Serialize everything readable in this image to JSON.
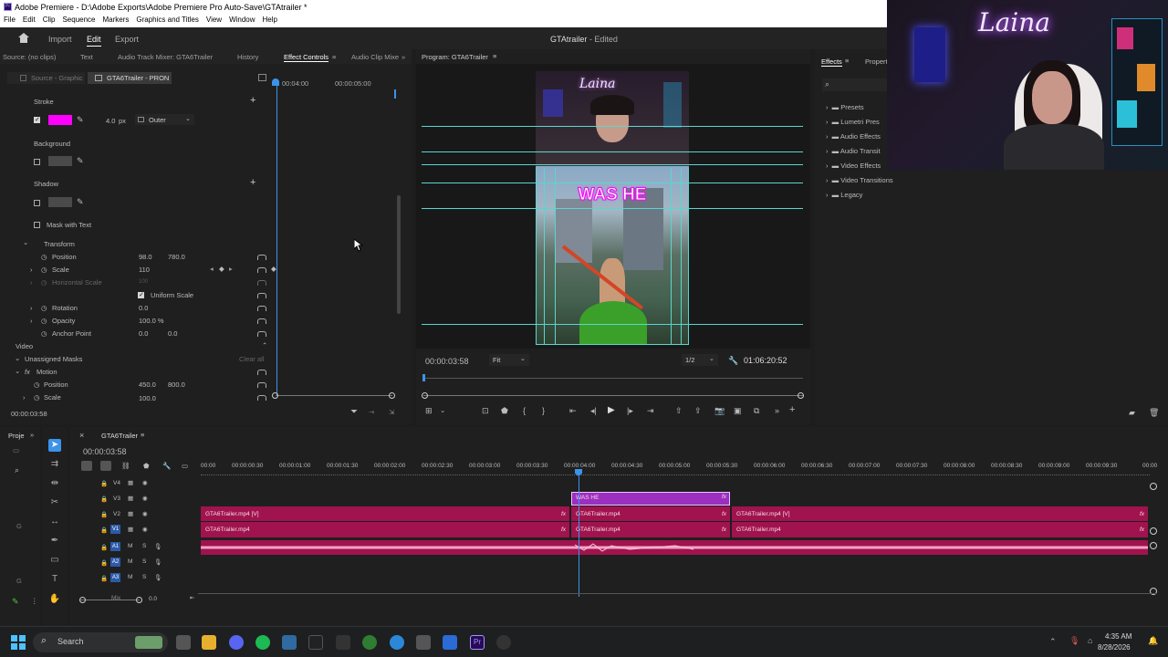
{
  "window": {
    "title": "Adobe Premiere - D:\\Adobe Exports\\Adobe Premiere Pro Auto-Save\\GTAtrailer *"
  },
  "menu": [
    "File",
    "Edit",
    "Clip",
    "Sequence",
    "Markers",
    "Graphics and Titles",
    "View",
    "Window",
    "Help"
  ],
  "appbar": {
    "import": "Import",
    "edit": "Edit",
    "export": "Export",
    "project_title": "GTAtrailer",
    "edited": "- Edited"
  },
  "source_tabs": {
    "source": "Source: (no clips)",
    "text": "Text",
    "audio_mixer": "Audio Track Mixer: GTA6Trailer",
    "history": "History",
    "effect_controls": "Effect Controls",
    "audio_clip": "Audio Clip Mixe"
  },
  "effect_controls": {
    "master": "Source - Graphic",
    "clip": "GTA6Trailer - PRON",
    "ruler_a": "00:04:00",
    "ruler_b": "00:00:05:00",
    "stroke": {
      "label": "Stroke",
      "color": "#ff00ff",
      "width": "4.0",
      "unit": "px",
      "position": "Outer"
    },
    "background": "Background",
    "shadow": "Shadow",
    "mask_text": "Mask with Text",
    "transform": "Transform",
    "position": {
      "label": "Position",
      "x": "98.0",
      "y": "780.0"
    },
    "scale": {
      "label": "Scale",
      "value": "110"
    },
    "hscale": {
      "label": "Horizontal Scale",
      "value": "100"
    },
    "uniform": "Uniform Scale",
    "rotation": {
      "label": "Rotation",
      "value": "0.0"
    },
    "opacity": {
      "label": "Opacity",
      "value": "100.0 %"
    },
    "anchor": {
      "label": "Anchor Point",
      "x": "0.0",
      "y": "0.0"
    },
    "video": "Video",
    "unassigned": "Unassigned Masks",
    "clear_all": "Clear all",
    "motion": "Motion",
    "m_position": {
      "label": "Position",
      "x": "450.0",
      "y": "800.0"
    },
    "m_scale": {
      "label": "Scale",
      "value": "100.0"
    },
    "timecode": "00:00:03:58"
  },
  "program": {
    "title": "Program: GTA6Trailer",
    "overlay_text": "WAS HE",
    "neon": "Laina",
    "timecode": "00:00:03:58",
    "fit": "Fit",
    "resolution": "1/2",
    "duration": "01:06:20:52"
  },
  "effects": {
    "tab": "Effects",
    "props": "Propert",
    "items": [
      "Presets",
      "Lumetri Pres",
      "Audio Effects",
      "Audio Transit",
      "Video Effects",
      "Video Transitions",
      "Legacy"
    ]
  },
  "webcam": {
    "neon": "Laina"
  },
  "project": {
    "label": "Proje"
  },
  "timeline": {
    "sequence": "GTA6Trailer",
    "timecode": "00:00:03:58",
    "ruler": [
      "00:00",
      "00:00:00:30",
      "00:00:01:00",
      "00:00:01:30",
      "00:00:02:00",
      "00:00:02:30",
      "00:00:03:00",
      "00:00:03:30",
      "00:00:04:00",
      "00:00:04:30",
      "00:00:05:00",
      "00:00:05:30",
      "00:00:06:00",
      "00:00:06:30",
      "00:00:07:00",
      "00:00:07:30",
      "00:00:08:00",
      "00:00:08:30",
      "00:00:09:00",
      "00:00:09:30",
      "00:00"
    ],
    "tracks_v": [
      "V4",
      "V3",
      "V2",
      "V1"
    ],
    "tracks_a": [
      "A1",
      "A2",
      "A3"
    ],
    "mix": "Mix",
    "mix_val": "0.0",
    "title_clip": "WAS HE",
    "clip_v": "GTA6Trailer.mp4 [V]",
    "clip": "GTA6Trailer.mp4"
  },
  "taskbar": {
    "search": "Search",
    "time": "4:35 AM",
    "date": "8/28/2026"
  }
}
